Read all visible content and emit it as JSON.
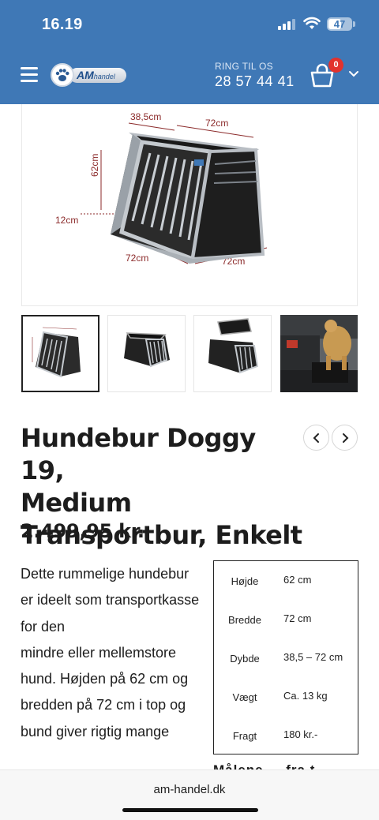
{
  "status_bar": {
    "time": "16.19",
    "battery": "47"
  },
  "header": {
    "logo_text": "AM",
    "logo_subtext": "handel",
    "ring_label": "RING TIL OS",
    "phone": "28 57 44 41",
    "cart_count": "0"
  },
  "main_image": {
    "dim_top_depth": "38,5cm",
    "dim_top_width": "72cm",
    "dim_height": "62cm",
    "dim_ground": "12cm",
    "dim_bottom_left": "72cm",
    "dim_bottom_right": "72cm"
  },
  "product": {
    "title_lines": [
      "Hundebur Doggy 19,",
      "Medium",
      "Transportbur, Enkelt"
    ],
    "price": "2.499,95 kr.",
    "description_lines": [
      "Dette rummelige hundebur",
      "er ideelt som transportkasse",
      "for den",
      "mindre eller mellemstore",
      "hund. Højden på 62 cm og",
      "bredden på 72 cm i top og",
      "bund giver rigtig mange"
    ]
  },
  "specs": [
    {
      "label": "Højde",
      "value": "62 cm"
    },
    {
      "label": "Bredde",
      "value": "72 cm"
    },
    {
      "label": "Dybde",
      "value": "38,5 – 72 cm"
    },
    {
      "label": "Vægt",
      "value": "Ca. 13 kg"
    },
    {
      "label": "Fragt",
      "value": "180 kr.-"
    }
  ],
  "cut_heading": "Målene ... fra t...",
  "browser": {
    "url": "am-handel.dk"
  },
  "colors": {
    "header_blue": "#3f78b6",
    "badge_red": "#e2322d",
    "dimension_red": "#8b2a2a"
  }
}
